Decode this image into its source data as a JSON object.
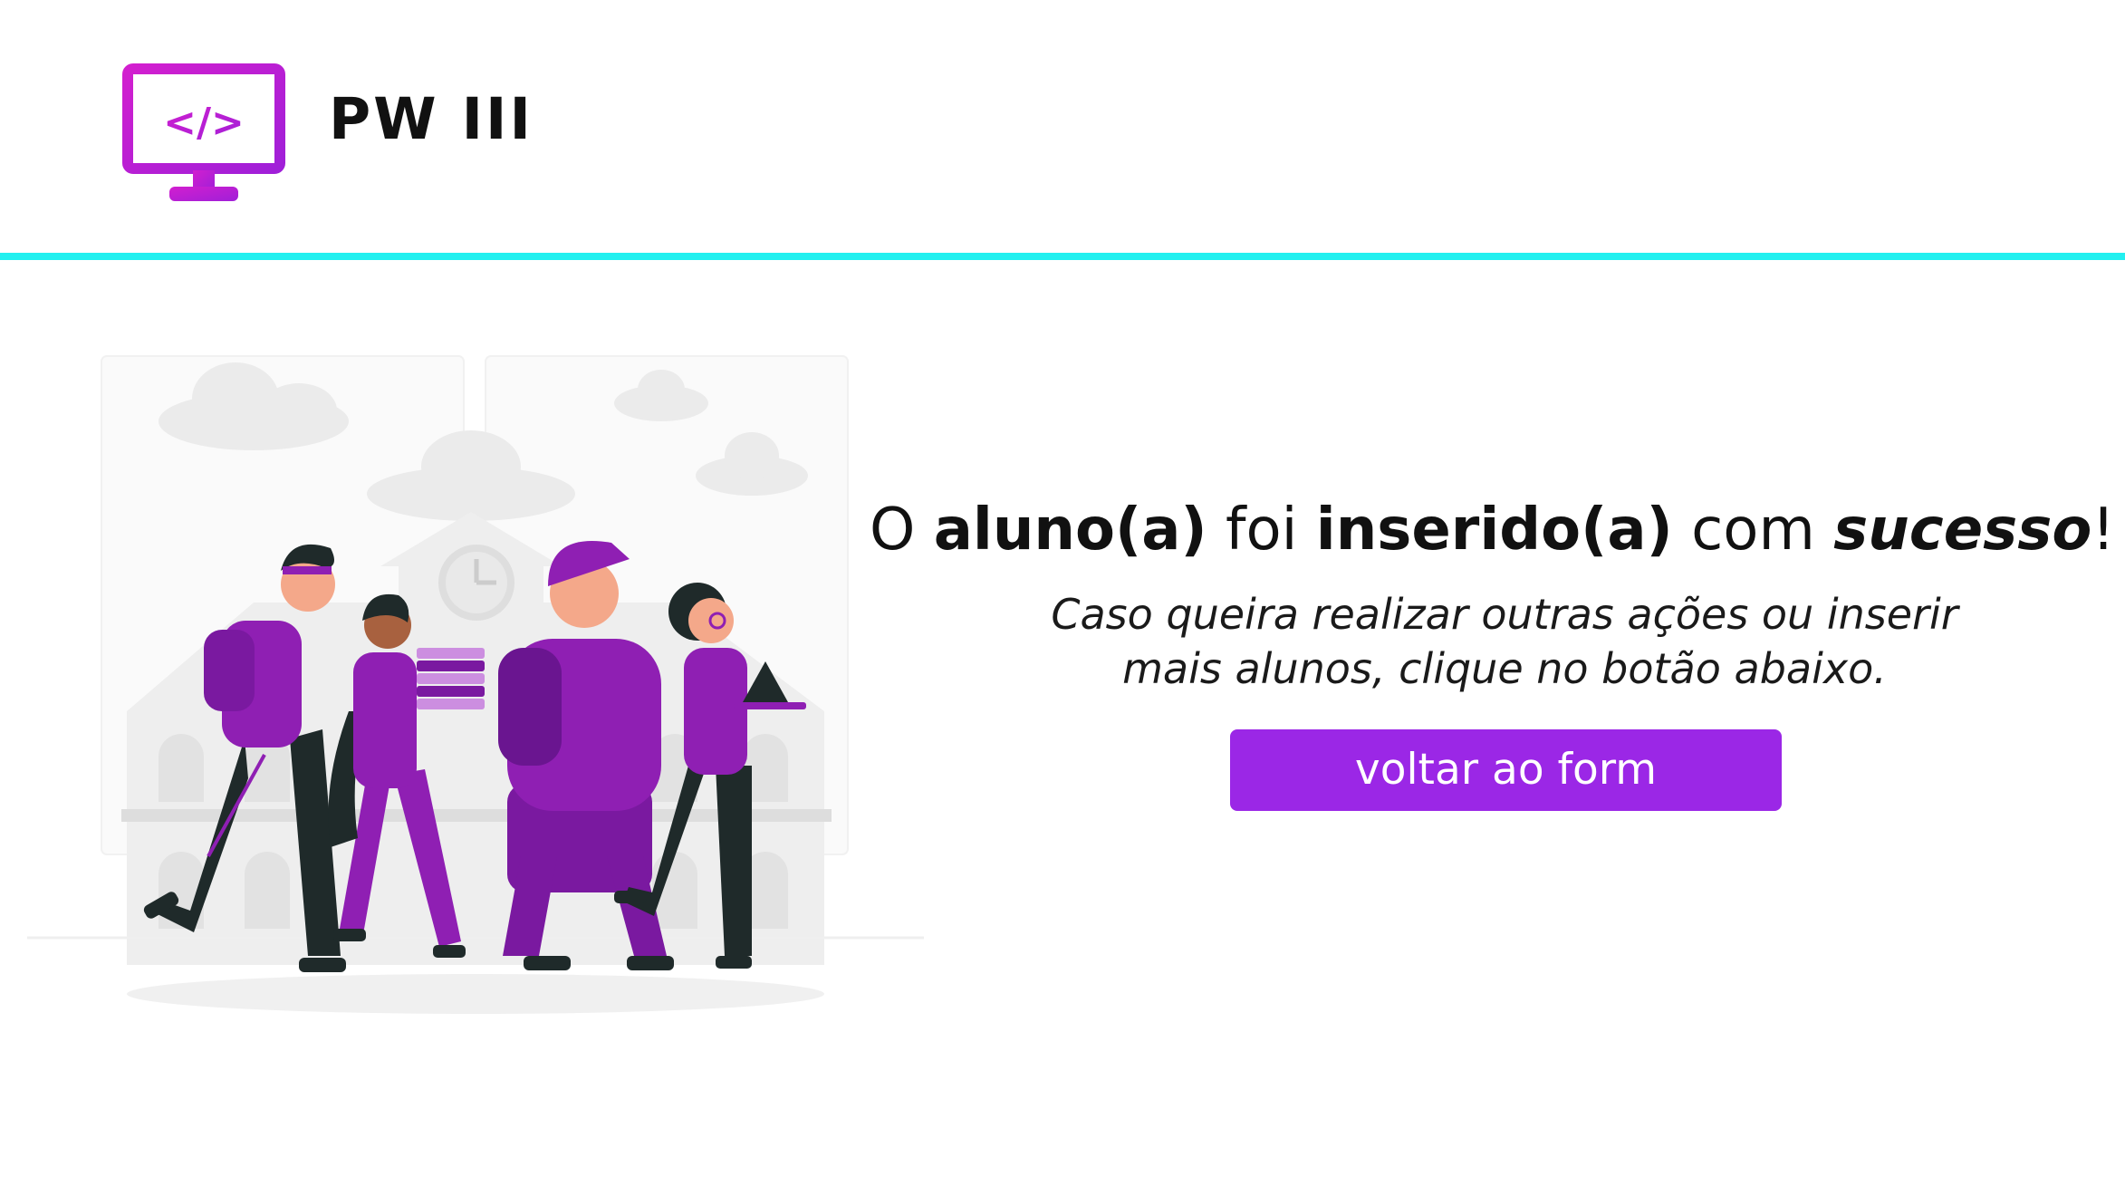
{
  "header": {
    "title": "PW III",
    "logo_icon": "code-monitor-icon",
    "logo_glyph": "</>"
  },
  "colors": {
    "accent_cyan": "#22f0f0",
    "button_purple": "#9b27e6",
    "logo_magenta": "#c21fd0",
    "illustration_purple": "#8f1fb3"
  },
  "main": {
    "headline": {
      "part1": "O ",
      "part2": "aluno(a)",
      "part3": " foi ",
      "part4": "inserido(a)",
      "part5": " com ",
      "part6": "sucesso",
      "part7": "!"
    },
    "subtext_line1": "Caso queira realizar outras ações ou inserir",
    "subtext_line2": "mais alunos, clique no botão abaixo.",
    "button_label": "voltar ao form"
  },
  "illustration": {
    "icon": "students-walking-illustration"
  }
}
